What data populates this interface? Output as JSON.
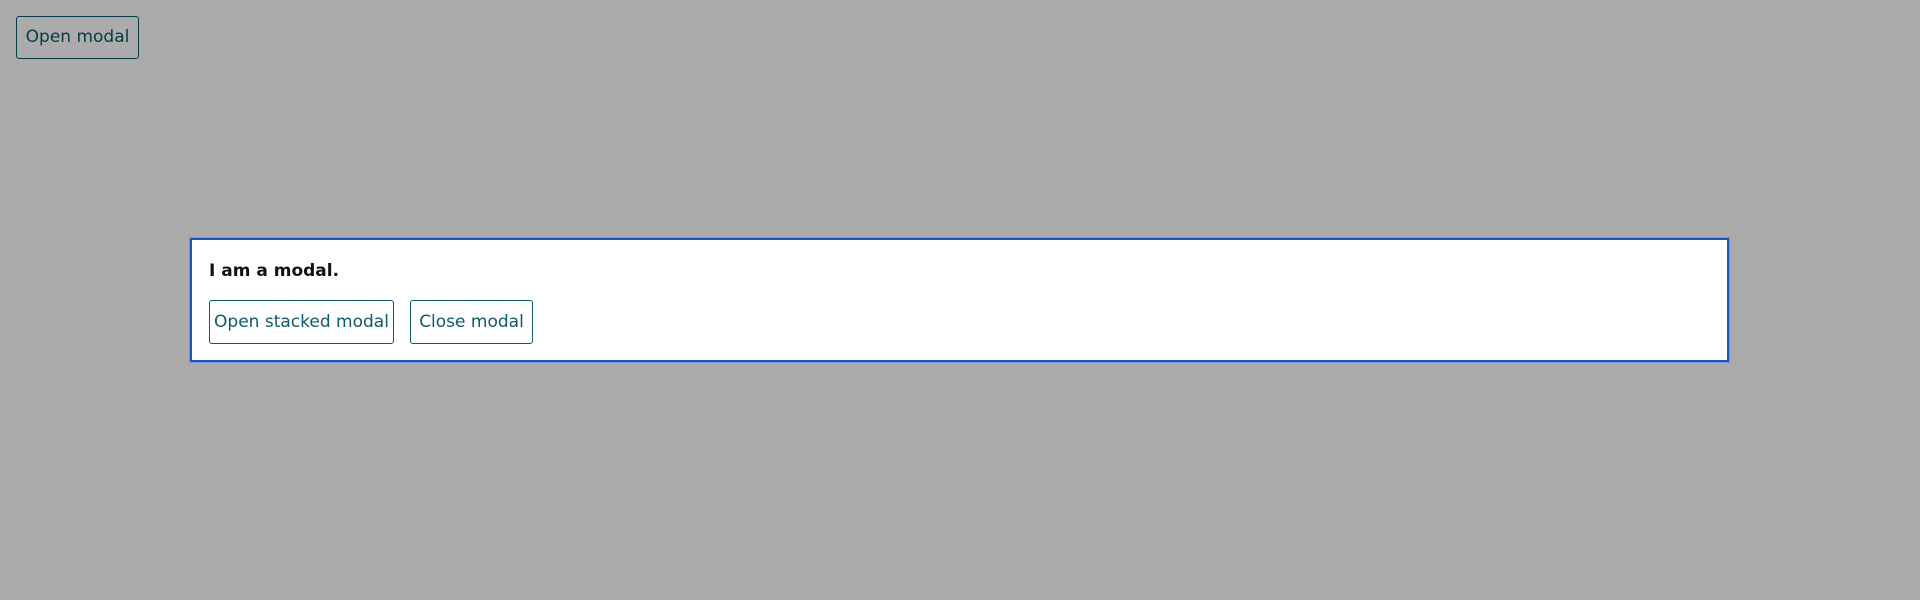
{
  "page": {
    "open_modal_label": "Open modal"
  },
  "modal": {
    "text": "I am a modal.",
    "open_stacked_label": "Open stacked modal",
    "close_label": "Close modal"
  },
  "colors": {
    "button_text": "#0e5a6a",
    "modal_border": "#1a56b8",
    "backdrop": "#a9a9a9"
  }
}
